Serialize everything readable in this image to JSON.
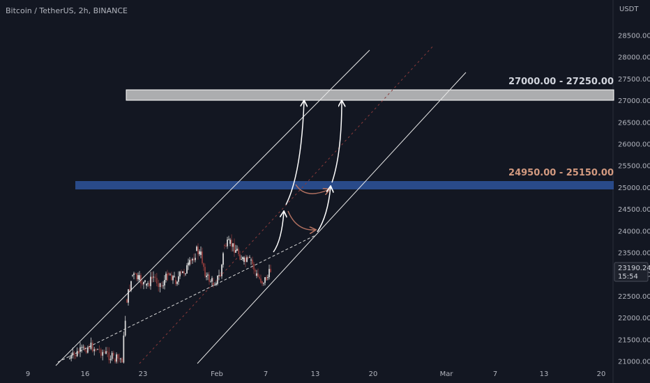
{
  "header": {
    "symbol": "Bitcoin / TetherUS, 2h, BINANCE"
  },
  "axis": {
    "currency": "USDT",
    "y_ticks": [
      "28500.00",
      "28000.00",
      "27500.00",
      "27000.00",
      "26500.00",
      "26000.00",
      "25500.00",
      "25000.00",
      "24500.00",
      "24000.00",
      "23500.00",
      "23000.00",
      "22500.00",
      "22000.00",
      "21500.00",
      "21000.00"
    ],
    "x_ticks": [
      "9",
      "16",
      "23",
      "Feb",
      "7",
      "13",
      "20",
      "Mar",
      "7",
      "13",
      "20"
    ]
  },
  "price_tag": {
    "price": "23190.24",
    "countdown": "15:54"
  },
  "zones": {
    "upper": {
      "label": "27000.00  -  27250.00",
      "color": "#c8c8c8"
    },
    "lower": {
      "label": "24950.00 - 25150.00",
      "color": "#2a4d8f"
    }
  },
  "colors": {
    "background": "#131722",
    "up_candle": "#d8d8d8",
    "down_candle": "#8a3a3a",
    "projection_line": "#8a3a3a",
    "lower_zone_label": "#d39a80",
    "upper_zone_label": "#d1d4dc"
  },
  "chart_data": {
    "type": "candlestick",
    "x_axis_ticks": [
      "9",
      "16",
      "23",
      "Feb",
      "7",
      "13",
      "20",
      "Mar",
      "7",
      "13",
      "20"
    ],
    "y_range": [
      21000,
      28900
    ],
    "last_price": 23190.24,
    "zones": [
      {
        "label": "27000.00  -  27250.00",
        "low": 27000,
        "high": 27250
      },
      {
        "label": "24950.00 - 25150.00",
        "low": 24950,
        "high": 25150
      }
    ]
  }
}
